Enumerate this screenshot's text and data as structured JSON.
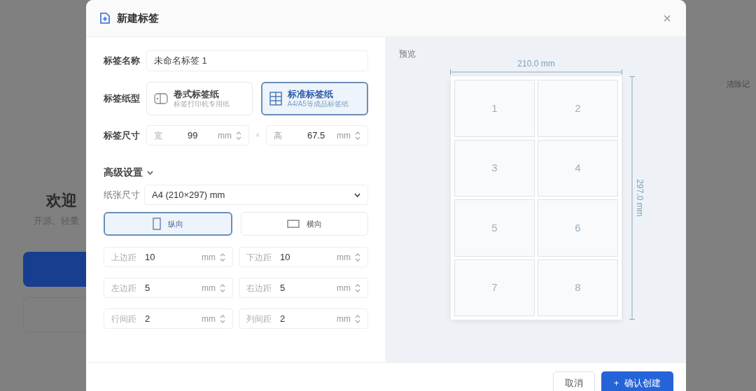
{
  "background_page": {
    "heading": "欢迎",
    "subtitle": "开源、轻量",
    "side_link": "清除记"
  },
  "dialog": {
    "title": "新建标签",
    "close": "×"
  },
  "form": {
    "name": {
      "label": "标签名称",
      "value": "未命名标签 1"
    },
    "paper_type": {
      "label": "标签纸型",
      "options": [
        {
          "kind": "roll",
          "title": "卷式标签纸",
          "subtitle": "标签打印机专用纸",
          "selected": false
        },
        {
          "kind": "sheet",
          "title": "标准标签纸",
          "subtitle": "A4/A5等成品标签纸",
          "selected": true
        }
      ]
    },
    "size": {
      "label": "标签尺寸",
      "separator": "×",
      "fields": [
        {
          "label": "宽",
          "value": "99",
          "unit": "mm"
        },
        {
          "label": "高",
          "value": "67.5",
          "unit": "mm"
        }
      ]
    },
    "advanced": {
      "label": "高级设置",
      "expanded": true
    },
    "paper_size": {
      "label": "纸张尺寸",
      "value": "A4 (210×297) mm"
    },
    "orientation": [
      {
        "kind": "portrait",
        "label": "纵向",
        "selected": true
      },
      {
        "kind": "landscape",
        "label": "横向",
        "selected": false
      }
    ],
    "margins": [
      {
        "label": "上边距",
        "value": "10",
        "unit": "mm"
      },
      {
        "label": "下边距",
        "value": "10",
        "unit": "mm"
      },
      {
        "label": "左边距",
        "value": "5",
        "unit": "mm"
      },
      {
        "label": "右边距",
        "value": "5",
        "unit": "mm"
      },
      {
        "label": "行间距",
        "value": "2",
        "unit": "mm"
      },
      {
        "label": "列间距",
        "value": "2",
        "unit": "mm"
      }
    ]
  },
  "preview": {
    "label": "预览",
    "width": "210.0 mm",
    "height": "297.0 mm",
    "cells": [
      "1",
      "2",
      "3",
      "4",
      "5",
      "6",
      "7",
      "8"
    ]
  },
  "footer": {
    "cancel": "取消",
    "confirm_icon": "+",
    "confirm": "确认创建"
  }
}
